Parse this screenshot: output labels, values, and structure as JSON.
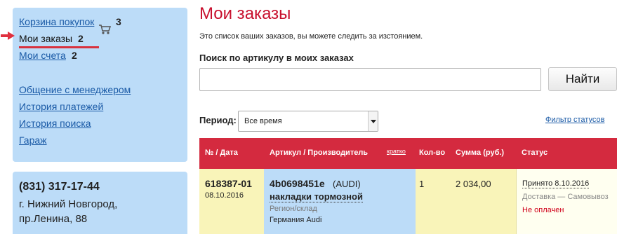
{
  "sidebar": {
    "cart_label": "Корзина покупок",
    "cart_count": "3",
    "orders_label": "Мои заказы",
    "orders_count": "2",
    "invoices_label": "Мои счета",
    "invoices_count": "2",
    "links": [
      "Общение с менеджером",
      "История платежей",
      "История поиска",
      "Гараж"
    ]
  },
  "contact": {
    "phone": "(831) 317-17-44",
    "city": "г. Нижний Новгород,",
    "street": "пр.Ленина, 88"
  },
  "main": {
    "title": "Мои заказы",
    "intro": "Это список ваших заказов, вы можете следить за изстоянием.",
    "search_label": "Поиск по артикулу в моих заказах",
    "search_value": "",
    "search_button": "Найти",
    "period_label": "Период:",
    "period_value": "Все время",
    "status_filter": "Фильтр статусов"
  },
  "table": {
    "headers": {
      "number_date": "№ / Дата",
      "article": "Артикул / Производитель",
      "article_short": "кратко",
      "qty": "Кол-во",
      "sum": "Сумма (руб.)",
      "status": "Статус"
    },
    "rows": [
      {
        "number": "618387-01",
        "date": "08.10.2016",
        "article": "4b0698451e",
        "brand": "(AUDI)",
        "name": "накладки тормозной",
        "region_label": "Регион/склад",
        "region": "Германия Audi",
        "qty": "1",
        "sum": "2 034,00",
        "status_accepted": "Принято 8.10.2016",
        "delivery": "Доставка — Самовывоз",
        "payment": "Не оплачен"
      }
    ]
  },
  "colors": {
    "accent_red": "#c8102e",
    "header_red": "#d42a3f",
    "sidebar_blue": "#bcdcf8",
    "link_blue": "#1a5aa6",
    "row_yellow": "#f9f4b9"
  },
  "icons": [
    "cart-icon",
    "red-arrow-icon",
    "dropdown-arrow-icon"
  ]
}
